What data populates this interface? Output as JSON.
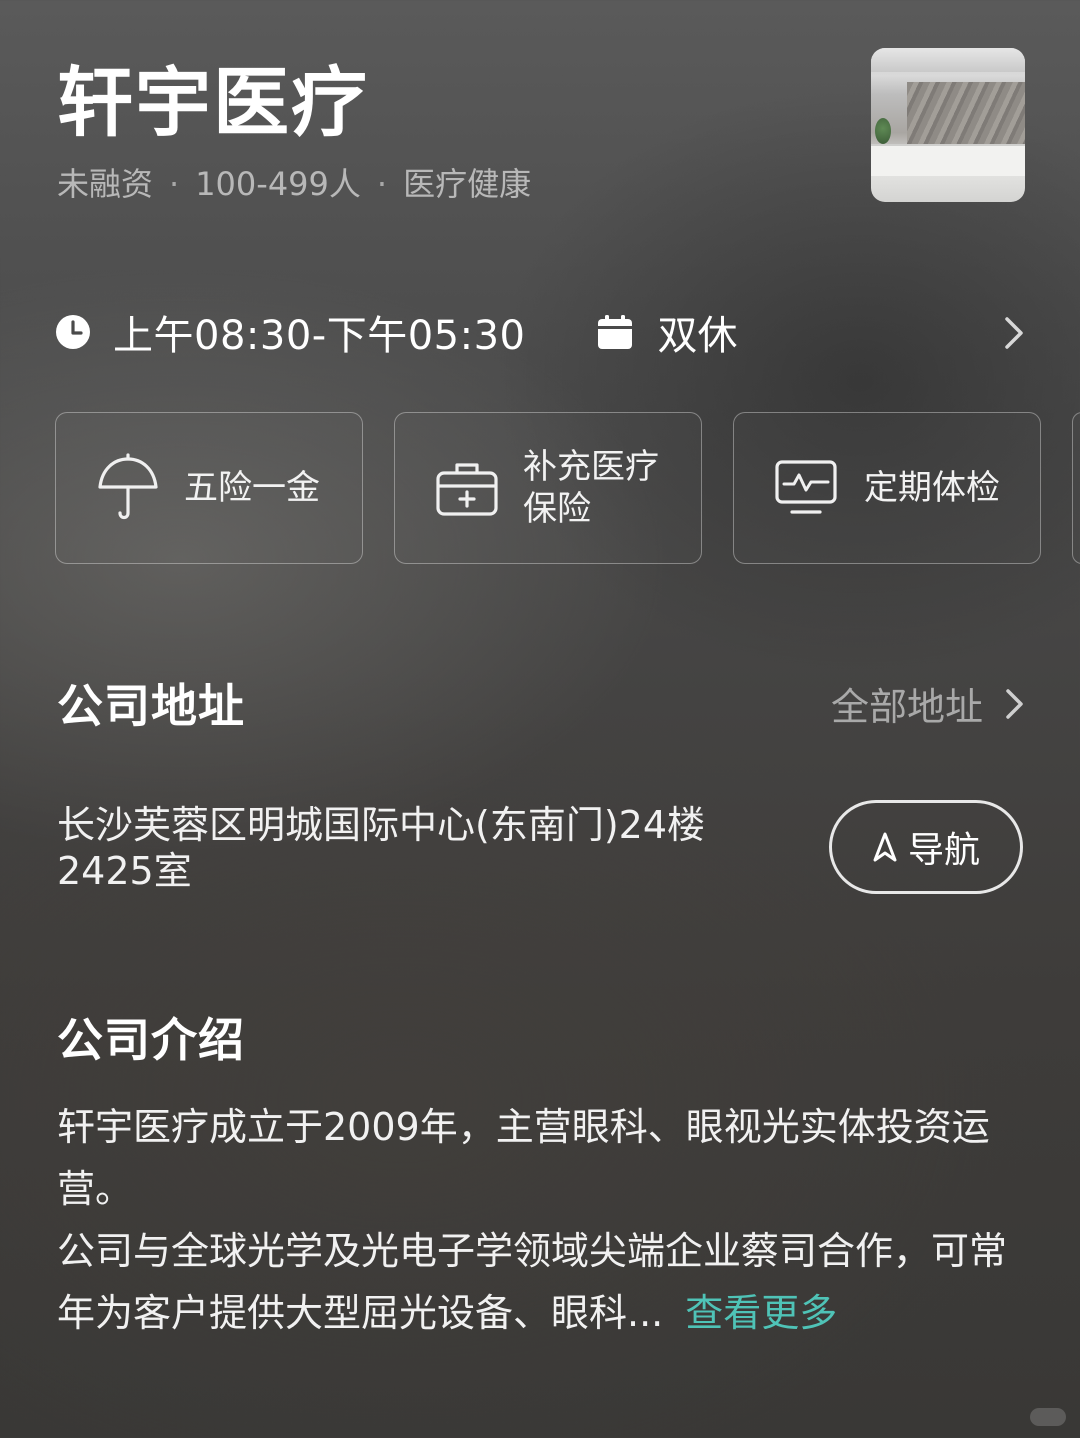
{
  "header": {
    "company_name": "轩宇医疗",
    "funding": "未融资",
    "size": "100-499人",
    "industry": "医疗健康",
    "separator": "·",
    "thumbnail_icon": "company-office-photo"
  },
  "schedule": {
    "hours": "上午08:30-下午05:30",
    "rest": "双休",
    "clock_icon": "clock-icon",
    "calendar_icon": "calendar-icon"
  },
  "benefits": [
    {
      "label": "五险一金",
      "icon": "umbrella-icon"
    },
    {
      "label_line1": "补充医疗",
      "label_line2": "保险",
      "icon": "medical-kit-icon"
    },
    {
      "label": "定期体检",
      "icon": "monitor-pulse-icon"
    }
  ],
  "address_section": {
    "title": "公司地址",
    "all_link": "全部地址",
    "address_line1": "长沙芙蓉区明城国际中心(东南门)24楼",
    "address_line2": "2425室",
    "nav_label": "导航"
  },
  "intro_section": {
    "title": "公司介绍",
    "paragraph1": "轩宇医疗成立于2009年，主营眼科、眼视光实体投资运营。",
    "paragraph2": "公司与全球光学及光电子学领域尖端企业蔡司合作，可常年为客户提供大型屈光设备、眼科...",
    "more_link": "查看更多"
  },
  "colors": {
    "accent_link": "#4fc3b7",
    "secondary_text": "#b8b8b8"
  }
}
